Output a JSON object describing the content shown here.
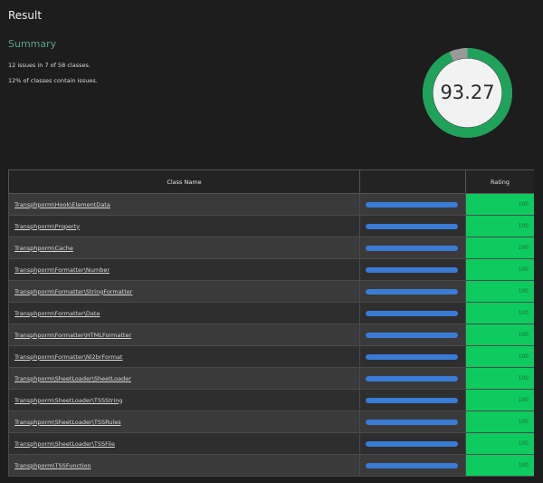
{
  "page": {
    "title": "Result"
  },
  "summary": {
    "heading": "Summary",
    "issues_line": "12 issues in 7 of 58 classes.",
    "percent_line": "12% of classes contain issues."
  },
  "gauge": {
    "value": "93.27",
    "fraction": 0.9327,
    "fill_color": "#1fa35a",
    "track_color": "#9a9a9a",
    "inner_color": "#f2f2f2"
  },
  "table": {
    "headers": {
      "class_name": "Class Name",
      "bar": "",
      "rating": "Rating"
    },
    "rows": [
      {
        "name": "Transphporm\\Hook\\ElementData",
        "rating": "100",
        "bar_fraction": 1
      },
      {
        "name": "Transphporm\\Property",
        "rating": "100",
        "bar_fraction": 1
      },
      {
        "name": "Transphporm\\Cache",
        "rating": "100",
        "bar_fraction": 1
      },
      {
        "name": "Transphporm\\Formatter\\Number",
        "rating": "100",
        "bar_fraction": 1
      },
      {
        "name": "Transphporm\\Formatter\\StringFormatter",
        "rating": "100",
        "bar_fraction": 1
      },
      {
        "name": "Transphporm\\Formatter\\Date",
        "rating": "100",
        "bar_fraction": 1
      },
      {
        "name": "Transphporm\\Formatter\\HTMLFormatter",
        "rating": "100",
        "bar_fraction": 1
      },
      {
        "name": "Transphporm\\Formatter\\Nl2brFormat",
        "rating": "100",
        "bar_fraction": 1
      },
      {
        "name": "Transphporm\\SheetLoader\\SheetLoader",
        "rating": "100",
        "bar_fraction": 1
      },
      {
        "name": "Transphporm\\SheetLoader\\TSSString",
        "rating": "100",
        "bar_fraction": 1
      },
      {
        "name": "Transphporm\\SheetLoader\\TSSRules",
        "rating": "100",
        "bar_fraction": 1
      },
      {
        "name": "Transphporm\\SheetLoader\\TSSFile",
        "rating": "100",
        "bar_fraction": 1
      },
      {
        "name": "Transphporm\\TSSFunction",
        "rating": "100",
        "bar_fraction": 1
      }
    ]
  },
  "colors": {
    "rating_bg": "#0ecb5f",
    "bar_fill": "#3a7bd5",
    "summary_heading": "#5fa38a"
  }
}
